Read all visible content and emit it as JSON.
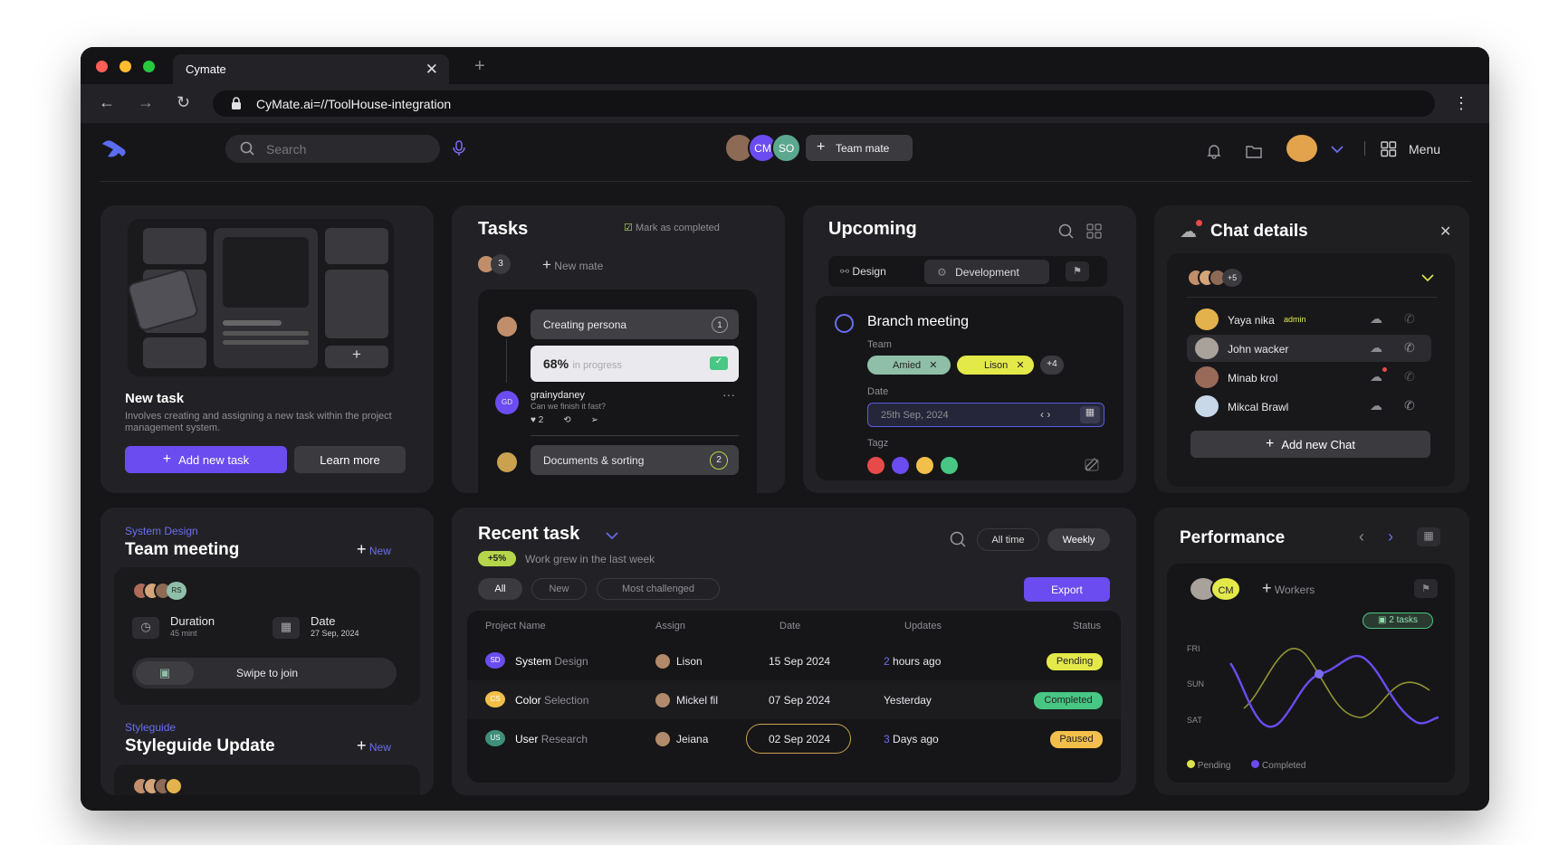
{
  "browser": {
    "tab_title": "Cymate",
    "url": "CyMate.ai=//ToolHouse-integration"
  },
  "header": {
    "search_placeholder": "Search",
    "team_avatars": [
      "CM",
      "SO"
    ],
    "team_mate_button": "Team mate",
    "menu_label": "Menu"
  },
  "new_task": {
    "title": "New task",
    "description": "Involves creating and assigning a new task within the project management system.",
    "primary_button": "Add new task",
    "secondary_button": "Learn more"
  },
  "tasks": {
    "title": "Tasks",
    "mark_completed": "Mark as completed",
    "member_count": "3",
    "new_mate": "New mate",
    "items": [
      {
        "label": "Creating persona",
        "count": "1"
      },
      {
        "label": "Documents & sorting",
        "count": "2"
      }
    ],
    "progress": {
      "percent": "68%",
      "status": "in progress",
      "value": 0.68
    },
    "comment": {
      "initials": "GD",
      "user": "grainydaney",
      "text": "Can we finish it fast?",
      "likes": "2"
    }
  },
  "upcoming": {
    "title": "Upcoming",
    "tabs": [
      "Design",
      "Development"
    ],
    "event_title": "Branch meeting",
    "team_label": "Team",
    "team_chips": [
      "Amied",
      "Lison"
    ],
    "team_more": "+4",
    "date_label": "Date",
    "date_value": "25th Sep, 2024",
    "tags_label": "Tagz",
    "tag_colors": [
      "#e84a4a",
      "#6a4cf0",
      "#f2c04a",
      "#47c783"
    ]
  },
  "chat": {
    "title": "Chat details",
    "more": "+5",
    "members": [
      {
        "name": "Yaya nika",
        "role": "admin"
      },
      {
        "name": "John wacker",
        "role": ""
      },
      {
        "name": "Minab krol",
        "role": ""
      },
      {
        "name": "Mikcal Brawl",
        "role": ""
      }
    ],
    "add_button": "Add new Chat"
  },
  "meetings": [
    {
      "category": "System Design",
      "title": "Team meeting",
      "new_label": "New",
      "avatar_tag": "RS",
      "duration_label": "Duration",
      "duration_value": "45 mint",
      "date_label": "Date",
      "date_value": "27 Sep, 2024",
      "join": "Swipe to join"
    },
    {
      "category": "Styleguide",
      "title": "Styleguide Update",
      "new_label": "New"
    }
  ],
  "recent": {
    "title": "Recent task",
    "growth_badge": "+5%",
    "growth_text": "Work grew in the last week",
    "ranges": [
      "All time",
      "Weekly"
    ],
    "filters": [
      "All",
      "New",
      "Most challenged"
    ],
    "export": "Export",
    "columns": [
      "Project Name",
      "Assign",
      "Date",
      "Updates",
      "Status"
    ],
    "rows": [
      {
        "init": "SD",
        "color": "#6a4cf0",
        "name": "System",
        "name2": "Design",
        "assign": "Lison",
        "date": "15 Sep 2024",
        "upd_num": "2",
        "upd_text": "hours ago",
        "status": "Pending",
        "status_color": "#e4e94a"
      },
      {
        "init": "CS",
        "color": "#f2c04a",
        "name": "Color",
        "name2": "Selection",
        "assign": "Mickel fil",
        "date": "07 Sep 2024",
        "upd_num": "",
        "upd_text": "Yesterday",
        "status": "Completed",
        "status_color": "#47c783"
      },
      {
        "init": "US",
        "color": "#3f8f7a",
        "name": "User",
        "name2": "Research",
        "assign": "Jeiana",
        "date": "02 Sep 2024",
        "upd_num": "3",
        "upd_text": "Days ago",
        "status": "Paused",
        "status_color": "#f2c04a"
      }
    ]
  },
  "performance": {
    "title": "Performance",
    "avatar_tag": "CM",
    "workers": "Workers",
    "tasks_badge": "2 tasks",
    "y_labels": [
      "FRI",
      "SUN",
      "SAT"
    ],
    "legend": [
      "Pending",
      "Completed"
    ],
    "colors": {
      "pending": "#dfe34a",
      "completed": "#6a4cf0"
    }
  }
}
